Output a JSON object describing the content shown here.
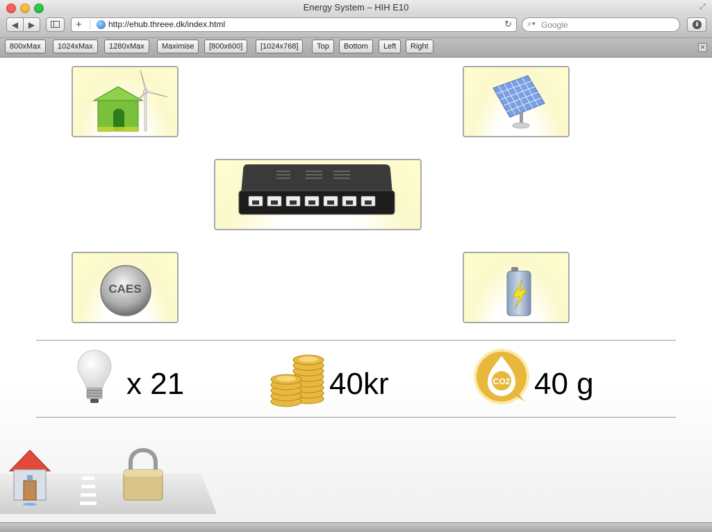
{
  "window": {
    "title": "Energy System – HIH E10",
    "fullscreen_icon": "fullscreen-arrows-icon"
  },
  "toolbar": {
    "back_icon": "back-arrow-icon",
    "forward_icon": "forward-arrow-icon",
    "reader_icon": "sidebar-icon",
    "add_icon": "plus-icon",
    "url": "http://ehub.threee.dk/index.html",
    "reload_icon": "reload-icon",
    "search_placeholder": "Google",
    "download_icon": "download-icon"
  },
  "bookmarks": [
    {
      "label": "800xMax"
    },
    {
      "label": "1024xMax"
    },
    {
      "label": "1280xMax"
    },
    {
      "label": "Maximise"
    },
    {
      "label": "[800x600]"
    },
    {
      "label": "[1024x768]"
    },
    {
      "label": "Top"
    },
    {
      "label": "Bottom"
    },
    {
      "label": "Left"
    },
    {
      "label": "Right"
    }
  ],
  "tiles": {
    "home_wind": {
      "icon": "house-wind-turbine-icon"
    },
    "solar": {
      "icon": "solar-panel-icon"
    },
    "hub": {
      "icon": "network-switch-icon"
    },
    "caes": {
      "icon": "caes-icon",
      "label": "CAES"
    },
    "battery": {
      "icon": "battery-icon"
    }
  },
  "stats": {
    "bulbs": {
      "icon": "light-bulb-icon",
      "value": "x 21"
    },
    "money": {
      "icon": "coins-icon",
      "value": "40kr"
    },
    "co2": {
      "icon": "co2-drop-icon",
      "badge": "CO2",
      "value": "40 g"
    }
  },
  "bottom_nav": {
    "home_icon": "home-icon",
    "lock_icon": "padlock-icon"
  },
  "colors": {
    "tile_bg": "#fffecf",
    "tile_border": "#a8a8a8",
    "house_green": "#7cc23a",
    "coin_gold": "#e3b43a",
    "co2_gold": "#e8b73c"
  }
}
